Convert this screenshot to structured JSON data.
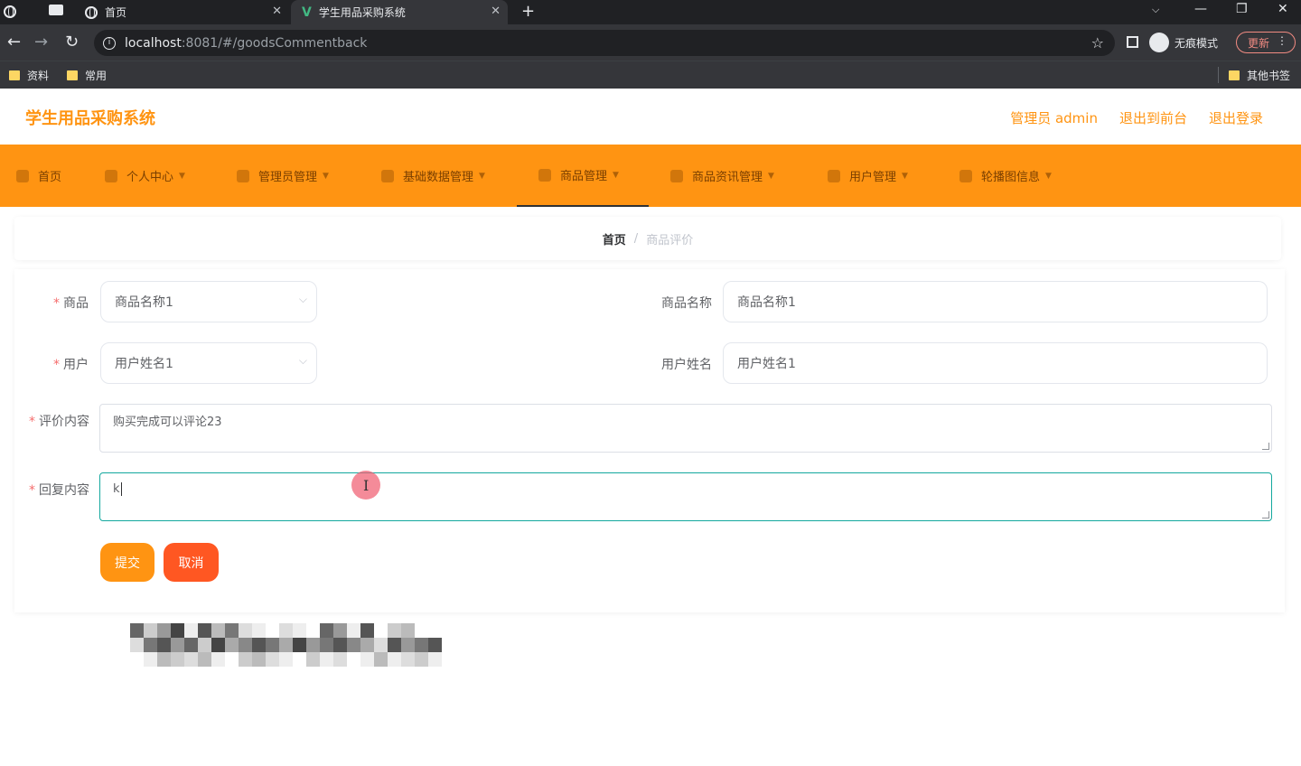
{
  "browser": {
    "tabs": [
      {
        "title": "首页",
        "icon": "globe-icon"
      },
      {
        "title": "学生用品采购系统",
        "icon": "vue-logo-icon",
        "active": true
      }
    ],
    "url_host": "localhost",
    "url_rest": ":8081/#/goodsCommentback",
    "incognito_label": "无痕模式",
    "update_label": "更新",
    "bookmarks": [
      "资料",
      "常用"
    ],
    "other_bookmarks": "其他书签"
  },
  "header": {
    "title": "学生用品采购系统",
    "admin_label": "管理员 admin",
    "to_front_label": "退出到前台",
    "logout_label": "退出登录"
  },
  "nav": {
    "items": [
      {
        "label": "首页",
        "icon": "home-icon"
      },
      {
        "label": "个人中心",
        "icon": "user-icon"
      },
      {
        "label": "管理员管理",
        "icon": "admin-icon"
      },
      {
        "label": "基础数据管理",
        "icon": "data-icon"
      },
      {
        "label": "商品管理",
        "icon": "goods-icon"
      },
      {
        "label": "商品资讯管理",
        "icon": "news-icon"
      },
      {
        "label": "用户管理",
        "icon": "users-icon"
      },
      {
        "label": "轮播图信息",
        "icon": "carousel-icon"
      }
    ],
    "active_index": 4
  },
  "breadcrumb": {
    "home": "首页",
    "separator": "/",
    "current": "商品评价"
  },
  "form": {
    "goods_label": "商品",
    "goods_value": "商品名称1",
    "goods_name_label": "商品名称",
    "goods_name_value": "商品名称1",
    "user_label": "用户",
    "user_value": "用户姓名1",
    "user_name_label": "用户姓名",
    "user_name_value": "用户姓名1",
    "comment_label": "评价内容",
    "comment_value": "购买完成可以评论23",
    "reply_label": "回复内容",
    "reply_value": "k",
    "submit_label": "提交",
    "cancel_label": "取消"
  },
  "colors": {
    "accent": "#ff9412",
    "cancel": "#ff5722",
    "required": "#f56c6c",
    "focus": "#13a89e"
  }
}
